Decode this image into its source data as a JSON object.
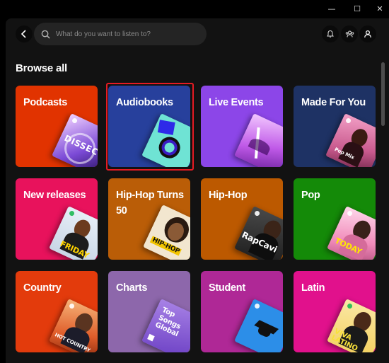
{
  "window": {
    "minimize_glyph": "—",
    "maximize_glyph": "☐",
    "close_glyph": "✕"
  },
  "header": {
    "search_placeholder": "What do you want to listen to?",
    "icons": [
      "chevron-left-icon",
      "search-icon",
      "bell-icon",
      "friends-icon",
      "user-icon"
    ]
  },
  "page": {
    "title": "Browse all"
  },
  "tiles": [
    {
      "label": "Podcasts",
      "color": "#e13300",
      "art": {
        "text": "DISSECT"
      }
    },
    {
      "label": "Audiobooks",
      "color": "#27409c",
      "art": {
        "text": ""
      }
    },
    {
      "label": "Live Events",
      "color": "#8c46e8",
      "art": {
        "text": ""
      }
    },
    {
      "label": "Made For You",
      "color": "#1e3264",
      "art": {
        "text": "Pop Mix"
      }
    },
    {
      "label": "New releases",
      "color": "#e8125c",
      "art": {
        "text": "FRIDAY"
      }
    },
    {
      "label": "Hip-Hop Turns 50",
      "color": "#ba5d07",
      "art": {
        "text": "HIP-HOP"
      }
    },
    {
      "label": "Hip-Hop",
      "color": "#bc5900",
      "art": {
        "text": "RapCavi"
      }
    },
    {
      "label": "Pop",
      "color": "#148a08",
      "art": {
        "text": "TODAY"
      }
    },
    {
      "label": "Country",
      "color": "#e33b0c",
      "art": {
        "text": "HOT COUNTRY"
      }
    },
    {
      "label": "Charts",
      "color": "#8d67ab",
      "art": {
        "text": "Top Songs Global"
      }
    },
    {
      "label": "Student",
      "color": "#af2896",
      "art": {
        "text": ""
      }
    },
    {
      "label": "Latin",
      "color": "#e1118c",
      "art": {
        "text": "VIVA LATINO"
      }
    }
  ],
  "colors": {
    "background": "#121212",
    "highlight_border": "#e51b23"
  }
}
